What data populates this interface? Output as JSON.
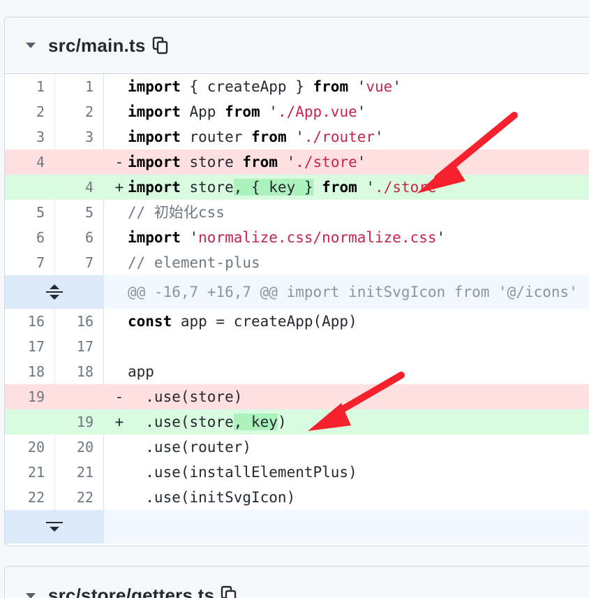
{
  "file1": {
    "path": "src/main.ts",
    "lines": [
      {
        "old": "1",
        "new": "1",
        "type": "ctx",
        "sign": " ",
        "parts": [
          [
            "kw",
            "import"
          ],
          [
            "t",
            " { createApp } "
          ],
          [
            "kw",
            "from"
          ],
          [
            "t",
            " '"
          ],
          [
            "str",
            "vue"
          ],
          [
            "t",
            "'"
          ]
        ]
      },
      {
        "old": "2",
        "new": "2",
        "type": "ctx",
        "sign": " ",
        "parts": [
          [
            "kw",
            "import"
          ],
          [
            "t",
            " App "
          ],
          [
            "kw",
            "from"
          ],
          [
            "t",
            " '"
          ],
          [
            "str",
            "./App.vue"
          ],
          [
            "t",
            "'"
          ]
        ]
      },
      {
        "old": "3",
        "new": "3",
        "type": "ctx",
        "sign": " ",
        "parts": [
          [
            "kw",
            "import"
          ],
          [
            "t",
            " router "
          ],
          [
            "kw",
            "from"
          ],
          [
            "t",
            " '"
          ],
          [
            "str",
            "./router"
          ],
          [
            "t",
            "'"
          ]
        ]
      },
      {
        "old": "4",
        "new": "",
        "type": "del",
        "sign": "-",
        "parts": [
          [
            "kw",
            "import"
          ],
          [
            "t",
            " store "
          ],
          [
            "kw",
            "from"
          ],
          [
            "t",
            " '"
          ],
          [
            "str",
            "./store"
          ],
          [
            "t",
            "'"
          ]
        ]
      },
      {
        "old": "",
        "new": "4",
        "type": "add",
        "sign": "+",
        "parts": [
          [
            "kw",
            "import"
          ],
          [
            "t",
            " store"
          ],
          [
            "hl",
            ", { key }"
          ],
          [
            "t",
            " "
          ],
          [
            "kw",
            "from"
          ],
          [
            "t",
            " '"
          ],
          [
            "str",
            "./store"
          ],
          [
            "t",
            "'"
          ]
        ]
      },
      {
        "old": "5",
        "new": "5",
        "type": "ctx",
        "sign": " ",
        "parts": [
          [
            "cmt",
            "// 初始化css"
          ]
        ]
      },
      {
        "old": "6",
        "new": "6",
        "type": "ctx",
        "sign": " ",
        "parts": [
          [
            "kw",
            "import"
          ],
          [
            "t",
            " '"
          ],
          [
            "str",
            "normalize.css/normalize.css"
          ],
          [
            "t",
            "'"
          ]
        ]
      },
      {
        "old": "7",
        "new": "7",
        "type": "ctx",
        "sign": " ",
        "parts": [
          [
            "cmt",
            "// element-plus"
          ]
        ]
      }
    ],
    "hunk": "@@ -16,7 +16,7 @@ import initSvgIcon from '@/icons'",
    "lines2": [
      {
        "old": "16",
        "new": "16",
        "type": "ctx",
        "sign": " ",
        "parts": [
          [
            "kw",
            "const"
          ],
          [
            "t",
            " app = createApp(App)"
          ]
        ]
      },
      {
        "old": "17",
        "new": "17",
        "type": "ctx",
        "sign": " ",
        "parts": []
      },
      {
        "old": "18",
        "new": "18",
        "type": "ctx",
        "sign": " ",
        "parts": [
          [
            "t",
            "app"
          ]
        ]
      },
      {
        "old": "19",
        "new": "",
        "type": "del",
        "sign": "-",
        "parts": [
          [
            "t",
            "  .use(store)"
          ]
        ]
      },
      {
        "old": "",
        "new": "19",
        "type": "add",
        "sign": "+",
        "parts": [
          [
            "t",
            "  .use(store"
          ],
          [
            "hl",
            ", key"
          ],
          [
            "t",
            ")"
          ]
        ]
      },
      {
        "old": "20",
        "new": "20",
        "type": "ctx",
        "sign": " ",
        "parts": [
          [
            "t",
            "  .use(router)"
          ]
        ]
      },
      {
        "old": "21",
        "new": "21",
        "type": "ctx",
        "sign": " ",
        "parts": [
          [
            "t",
            "  .use(installElementPlus)"
          ]
        ]
      },
      {
        "old": "22",
        "new": "22",
        "type": "ctx",
        "sign": " ",
        "parts": [
          [
            "t",
            "  .use(initSvgIcon)"
          ]
        ]
      }
    ]
  },
  "file2": {
    "path": "src/store/getters.ts"
  },
  "colors": {
    "annotation_arrow": "#f5222d"
  },
  "icons": {
    "collapse": "caret-down-icon",
    "copy": "copy-icon",
    "expand_up_down": "expand-icon",
    "expand_down": "expand-down-icon"
  }
}
